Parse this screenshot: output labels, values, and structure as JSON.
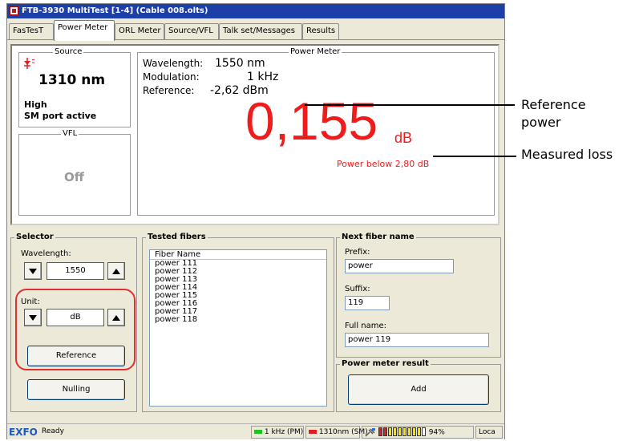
{
  "window": {
    "title": "FTB-3930 MultiTest [1-4] (Cable 008.olts)",
    "app_icon": "app-icon"
  },
  "tabs": [
    {
      "label": "FasTesT"
    },
    {
      "label": "Power Meter",
      "active": true
    },
    {
      "label": "ORL Meter"
    },
    {
      "label": "Source/VFL"
    },
    {
      "label": "Talk set/Messages"
    },
    {
      "label": "Results"
    }
  ],
  "source": {
    "legend": "Source",
    "icon": "laser-source-icon",
    "wavelength": "1310 nm",
    "level": "High",
    "port": "SM port active"
  },
  "vfl": {
    "legend": "VFL",
    "state": "Off"
  },
  "power_meter": {
    "legend": "Power Meter",
    "wavelength_label": "Wavelength:",
    "wavelength_value": "1550 nm",
    "modulation_label": "Modulation:",
    "modulation_value": "1 kHz",
    "reference_label": "Reference:",
    "reference_value": "-2,62 dBm",
    "reading": "0,155",
    "reading_unit": "dB",
    "status": "Power below 2,80 dB"
  },
  "selector": {
    "legend": "Selector",
    "wavelength_label": "Wavelength:",
    "wavelength_value": "1550",
    "unit_label": "Unit:",
    "unit_value": "dB",
    "reference_button": "Reference",
    "nulling_button": "Nulling"
  },
  "tested_fibers": {
    "legend": "Tested fibers",
    "column_header": "Fiber Name",
    "items": [
      "power 111",
      "power 112",
      "power 113",
      "power 114",
      "power 115",
      "power 116",
      "power 117",
      "power 118"
    ]
  },
  "next_fiber": {
    "legend": "Next fiber name",
    "prefix_label": "Prefix:",
    "prefix_value": "power",
    "suffix_label": "Suffix:",
    "suffix_value": "119",
    "fullname_label": "Full name:",
    "fullname_value": "power 119"
  },
  "result": {
    "legend": "Power meter result",
    "add_button": "Add"
  },
  "statusbar": {
    "brand": "EXFO",
    "status": "Ready",
    "modulation": "1 kHz (PM)",
    "source": "1310nm (SM)",
    "battery_percent": "94%",
    "battery_level": 0.94,
    "locale": "Loca"
  },
  "colors": {
    "reading_red": "#ee1c1c",
    "title_blue": "#1d3fa8",
    "exfo_blue": "#1b58c4",
    "highlight": "#e03030"
  },
  "annotations": {
    "reference_power_line1": "Reference",
    "reference_power_line2": "power",
    "measured_loss": "Measured loss"
  }
}
